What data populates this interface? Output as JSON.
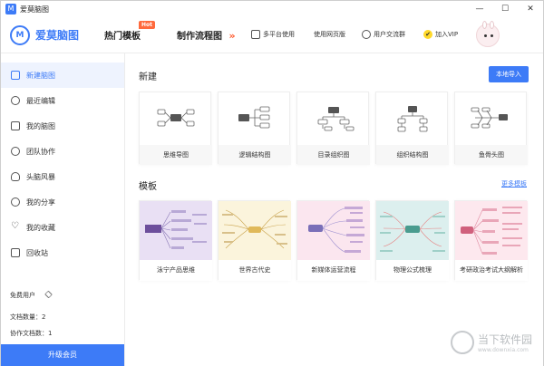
{
  "window": {
    "title": "爱莫脑图",
    "app_icon": "M",
    "minimize": "—",
    "maximize": "☐",
    "close": "✕"
  },
  "header": {
    "logo_mark": "M",
    "logo_text": "爱莫脑图",
    "nav_hot": "热门模板",
    "hot_badge": "Hot",
    "nav_flow": "制作流程图",
    "chevron": "»",
    "links": [
      "多平台使用",
      "使用网页版",
      "用户交流群",
      "加入VIP"
    ],
    "vip_mark": "✔"
  },
  "sidebar": {
    "items": [
      {
        "label": "新建脑图",
        "icon": "new-file-icon",
        "active": true
      },
      {
        "label": "最近编辑",
        "icon": "clock-icon",
        "active": false
      },
      {
        "label": "我的脑图",
        "icon": "document-icon",
        "active": false
      },
      {
        "label": "团队协作",
        "icon": "team-icon",
        "active": false
      },
      {
        "label": "头脑风暴",
        "icon": "bulb-icon",
        "active": false
      },
      {
        "label": "我的分享",
        "icon": "share-icon",
        "active": false
      },
      {
        "label": "我的收藏",
        "icon": "heart-icon",
        "active": false
      },
      {
        "label": "回收站",
        "icon": "trash-icon",
        "active": false
      }
    ],
    "user_type": "免费用户",
    "doc_count_label": "文档数量：",
    "doc_count": "2",
    "collab_count_label": "协作文档数：",
    "collab_count": "1",
    "upgrade": "升级会员"
  },
  "main": {
    "new_title": "新建",
    "import_btn": "本地导入",
    "new_cards": [
      "思维导图",
      "逻辑结构图",
      "目录组织图",
      "组织结构图",
      "鱼骨头图"
    ],
    "template_title": "模板",
    "more_templates": "更多模板",
    "templates": [
      {
        "label": "泳宁产品思维",
        "bg": "#e9e0f4",
        "accent": "#7b5ea7"
      },
      {
        "label": "世界古代史",
        "bg": "#fbf4dc",
        "accent": "#c79b3a"
      },
      {
        "label": "新媒体运营流程",
        "bg": "#fbe6ef",
        "accent": "#7a6fb8"
      },
      {
        "label": "物理公式梳理",
        "bg": "#dcefee",
        "accent": "#4a9c8f"
      },
      {
        "label": "考研政治考试大纲解析",
        "bg": "#fde8ee",
        "accent": "#d0607c"
      }
    ]
  },
  "watermark": {
    "cn": "当下软件园",
    "en": "www.downxia.com"
  },
  "colors": {
    "brand": "#3d7bf7",
    "hot": "#ff6a3d",
    "active_bg": "#eef3fe"
  }
}
